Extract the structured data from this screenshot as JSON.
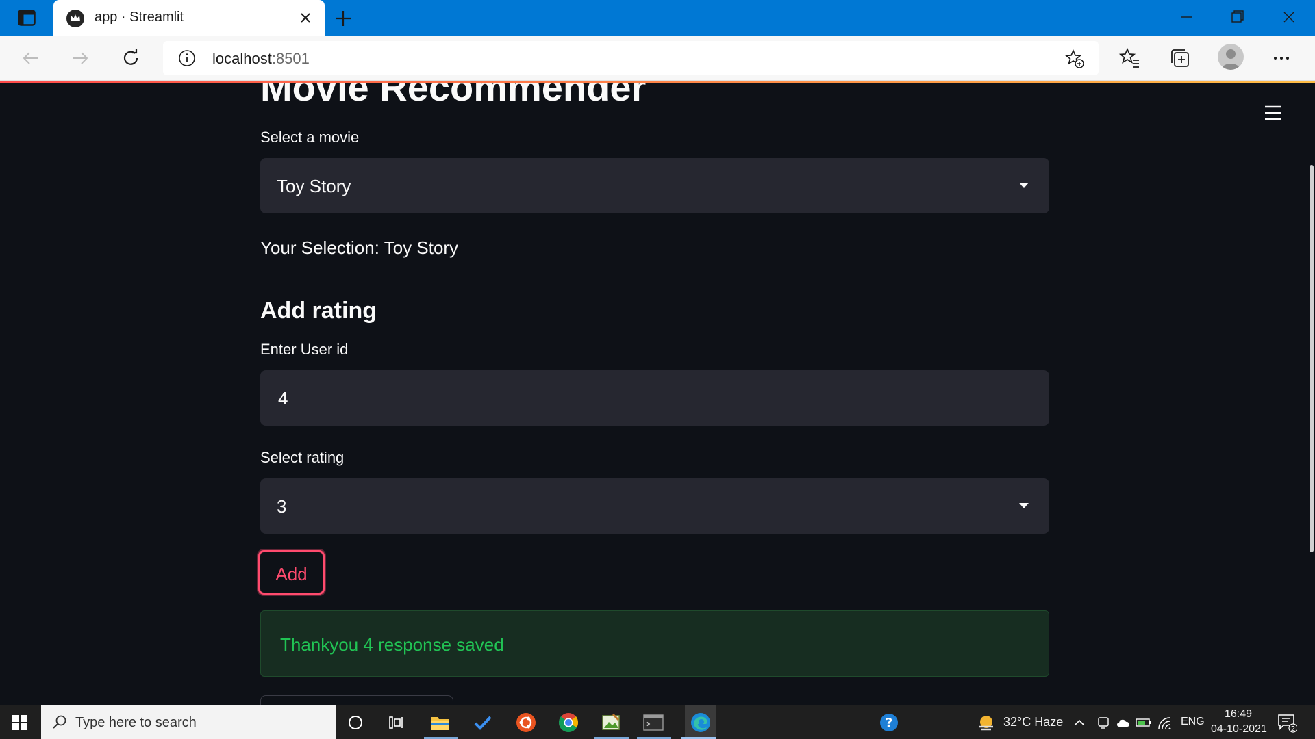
{
  "browser": {
    "tab_title": "app · Streamlit",
    "url_host": "localhost",
    "url_port": ":8501"
  },
  "app": {
    "title": "Movie Recommender",
    "movie_select": {
      "label": "Select a movie",
      "value": "Toy Story"
    },
    "selection_text": "Your Selection: Toy Story",
    "add_rating": {
      "heading": "Add rating",
      "user_id": {
        "label": "Enter User id",
        "value": "4"
      },
      "rating_select": {
        "label": "Select rating",
        "value": "3"
      },
      "add_button": "Add"
    },
    "success_message": "Thankyou 4 response saved"
  },
  "taskbar": {
    "search_placeholder": "Type here to search",
    "weather": "32°C  Haze",
    "language": "ENG",
    "time": "16:49",
    "date": "04-10-2021",
    "notifications_count": "2"
  },
  "colors": {
    "browser_accent": "#0078d4",
    "app_background": "#0e1117",
    "widget_background": "#262730",
    "primary": "#ff4b6e",
    "success_text": "#21c354",
    "success_background": "#172d21"
  }
}
